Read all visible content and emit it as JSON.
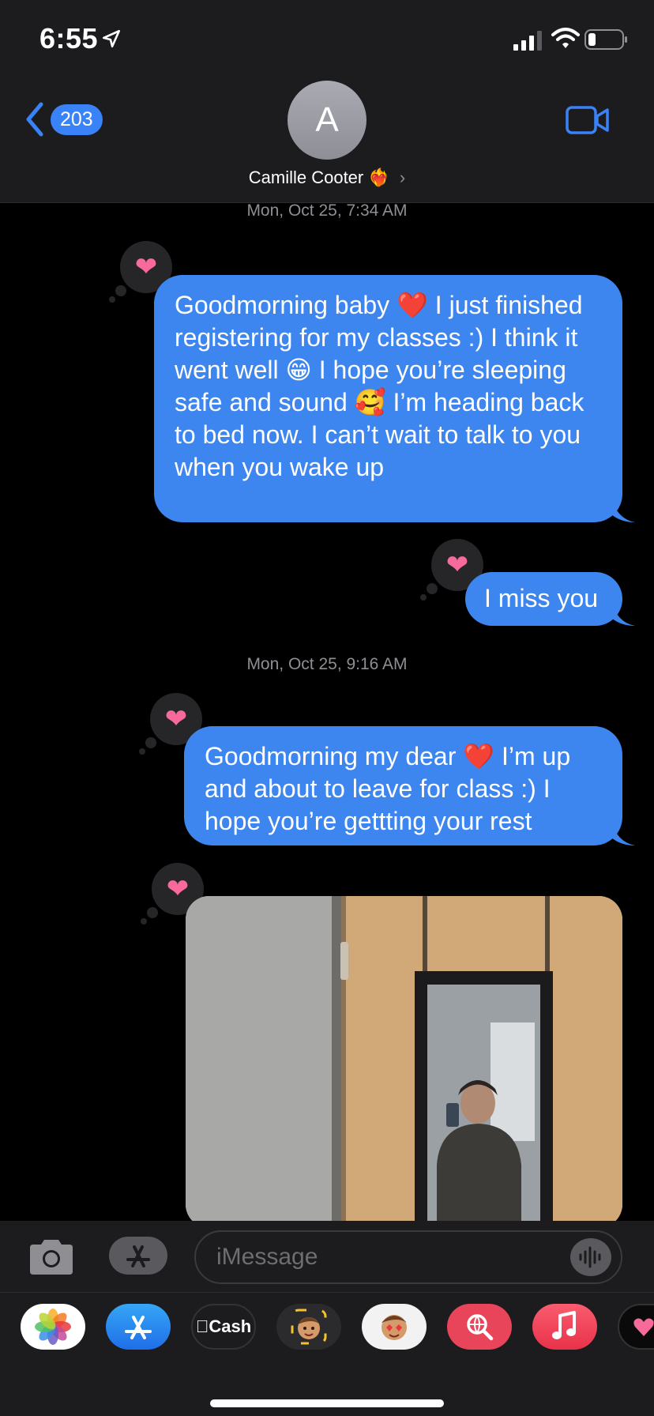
{
  "status_bar": {
    "time": "6:55"
  },
  "header": {
    "back_count": "203",
    "avatar_initial": "A",
    "contact_name": "Camille Cooter",
    "contact_emoji": "❤️‍🔥",
    "chevron": "›"
  },
  "messages": [
    {
      "timestamp": "Mon, Oct 25, 7:34 AM",
      "text": "Goodmorning baby ❤️ I just finished registering for my classes :) I think it went well 😁 I hope you’re sleeping safe and sound 🥰 I’m heading back to bed now. I can’t wait to talk to you when you wake up",
      "tapback": "❤"
    },
    {
      "text": "I miss you",
      "tapback": "❤"
    },
    {
      "timestamp": "Mon, Oct 25, 9:16 AM",
      "text": "Goodmorning my dear ❤️ I’m up and about to leave for class :) I hope you’re gettting your rest",
      "tapback": "❤"
    },
    {
      "type": "photo",
      "tapback": "❤"
    }
  ],
  "input": {
    "placeholder": "iMessage"
  },
  "app_drawer": {
    "apps": [
      "photos-icon",
      "app-store-icon",
      "apple-cash-icon",
      "memoji-icon",
      "animoji-icon",
      "web-search-icon",
      "music-icon",
      "digital-touch-icon"
    ],
    "cash_label": "Cash"
  },
  "colors": {
    "bubble": "#3d86ef",
    "tapback_heart": "#f76a9b",
    "header_bg": "#1c1c1e"
  }
}
